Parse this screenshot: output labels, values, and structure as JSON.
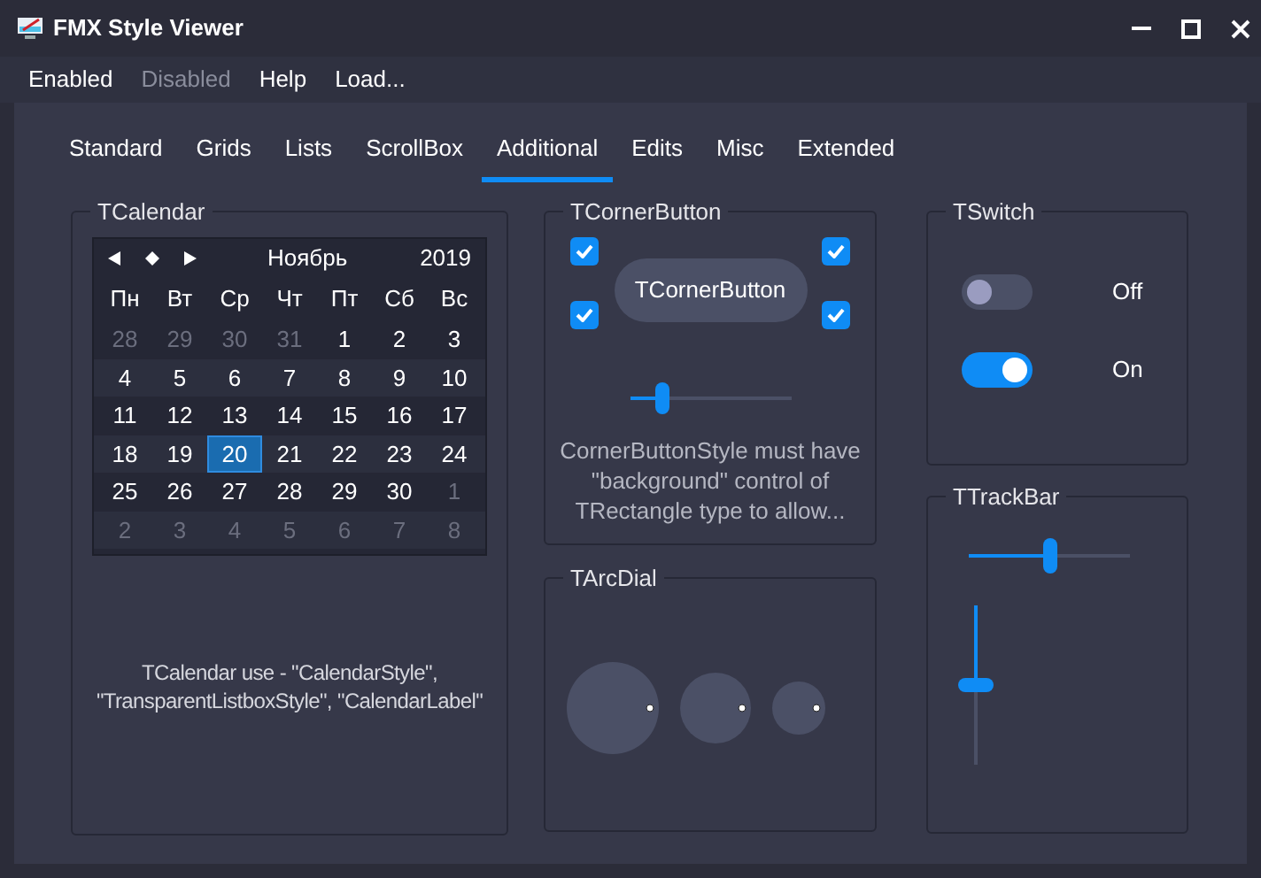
{
  "window": {
    "title": "FMX Style Viewer"
  },
  "menu": [
    {
      "label": "Enabled",
      "disabled": false
    },
    {
      "label": "Disabled",
      "disabled": true
    },
    {
      "label": "Help",
      "disabled": false
    },
    {
      "label": "Load...",
      "disabled": false
    }
  ],
  "tabs": [
    {
      "label": "Standard",
      "selected": false
    },
    {
      "label": "Grids",
      "selected": false
    },
    {
      "label": "Lists",
      "selected": false
    },
    {
      "label": "ScrollBox",
      "selected": false
    },
    {
      "label": "Additional",
      "selected": true
    },
    {
      "label": "Edits",
      "selected": false
    },
    {
      "label": "Misc",
      "selected": false
    },
    {
      "label": "Extended",
      "selected": false
    }
  ],
  "calendar_group": {
    "title": "TCalendar",
    "month": "Ноябрь",
    "year": "2019",
    "weekdays": [
      "Пн",
      "Вт",
      "Ср",
      "Чт",
      "Пт",
      "Сб",
      "Вс"
    ],
    "weeks": [
      [
        {
          "day": "28",
          "other_month": true,
          "selected": false
        },
        {
          "day": "29",
          "other_month": true,
          "selected": false
        },
        {
          "day": "30",
          "other_month": true,
          "selected": false
        },
        {
          "day": "31",
          "other_month": true,
          "selected": false
        },
        {
          "day": "1",
          "other_month": false,
          "selected": false
        },
        {
          "day": "2",
          "other_month": false,
          "selected": false
        },
        {
          "day": "3",
          "other_month": false,
          "selected": false
        }
      ],
      [
        {
          "day": "4",
          "other_month": false,
          "selected": false
        },
        {
          "day": "5",
          "other_month": false,
          "selected": false
        },
        {
          "day": "6",
          "other_month": false,
          "selected": false
        },
        {
          "day": "7",
          "other_month": false,
          "selected": false
        },
        {
          "day": "8",
          "other_month": false,
          "selected": false
        },
        {
          "day": "9",
          "other_month": false,
          "selected": false
        },
        {
          "day": "10",
          "other_month": false,
          "selected": false
        }
      ],
      [
        {
          "day": "11",
          "other_month": false,
          "selected": false
        },
        {
          "day": "12",
          "other_month": false,
          "selected": false
        },
        {
          "day": "13",
          "other_month": false,
          "selected": false
        },
        {
          "day": "14",
          "other_month": false,
          "selected": false
        },
        {
          "day": "15",
          "other_month": false,
          "selected": false
        },
        {
          "day": "16",
          "other_month": false,
          "selected": false
        },
        {
          "day": "17",
          "other_month": false,
          "selected": false
        }
      ],
      [
        {
          "day": "18",
          "other_month": false,
          "selected": false
        },
        {
          "day": "19",
          "other_month": false,
          "selected": false
        },
        {
          "day": "20",
          "other_month": false,
          "selected": true
        },
        {
          "day": "21",
          "other_month": false,
          "selected": false
        },
        {
          "day": "22",
          "other_month": false,
          "selected": false
        },
        {
          "day": "23",
          "other_month": false,
          "selected": false
        },
        {
          "day": "24",
          "other_month": false,
          "selected": false
        }
      ],
      [
        {
          "day": "25",
          "other_month": false,
          "selected": false
        },
        {
          "day": "26",
          "other_month": false,
          "selected": false
        },
        {
          "day": "27",
          "other_month": false,
          "selected": false
        },
        {
          "day": "28",
          "other_month": false,
          "selected": false
        },
        {
          "day": "29",
          "other_month": false,
          "selected": false
        },
        {
          "day": "30",
          "other_month": false,
          "selected": false
        },
        {
          "day": "1",
          "other_month": true,
          "selected": false
        }
      ],
      [
        {
          "day": "2",
          "other_month": true,
          "selected": false
        },
        {
          "day": "3",
          "other_month": true,
          "selected": false
        },
        {
          "day": "4",
          "other_month": true,
          "selected": false
        },
        {
          "day": "5",
          "other_month": true,
          "selected": false
        },
        {
          "day": "6",
          "other_month": true,
          "selected": false
        },
        {
          "day": "7",
          "other_month": true,
          "selected": false
        },
        {
          "day": "8",
          "other_month": true,
          "selected": false
        }
      ]
    ],
    "caption": "TCalendar use - \"CalendarStyle\", \"TransparentListboxStyle\", \"CalendarLabel\""
  },
  "corner_button_group": {
    "title": "TCornerButton",
    "checkboxes": [
      {
        "checked": true
      },
      {
        "checked": true
      },
      {
        "checked": true
      },
      {
        "checked": true
      }
    ],
    "button": "TCornerButton",
    "slider": {
      "level": 0.2
    },
    "note": "CornerButtonStyle must have \"background\" control of TRectangle type to allow..."
  },
  "arc_dial_group": {
    "title": "TArcDial"
  },
  "switch_group": {
    "title": "TSwitch",
    "switches": [
      {
        "label": "Off",
        "on": false
      },
      {
        "label": "On",
        "on": true
      }
    ]
  },
  "trackbar_group": {
    "title": "TTrackBar",
    "horizontal": {
      "level": 0.5
    },
    "vertical": {
      "level": 0.5
    }
  }
}
